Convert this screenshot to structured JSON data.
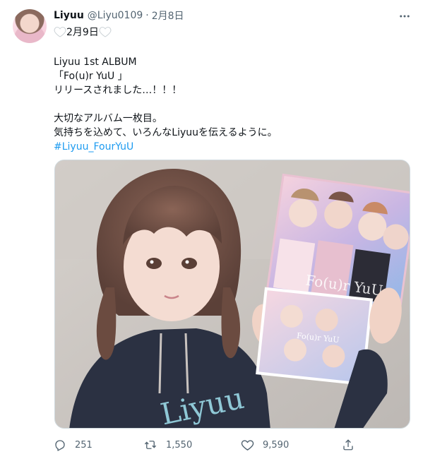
{
  "tweet": {
    "display_name": "Liyuu",
    "handle": "@Liyu0109",
    "separator": "·",
    "time": "2月8日",
    "first_line_text": "2月9日",
    "lines": [
      "Liyuu 1st ALBUM",
      "「Fo(u)r YuU 」",
      "リリースされました…！！！",
      "",
      "大切なアルバム一枚目。",
      "気持ちを込めて、いろんなLiyuuを伝えるように。"
    ],
    "hashtag": "#Liyuu_FourYuU",
    "media": {
      "album_cover_text": "Fo(u)r YuU",
      "album_small_text": "Fo(u)r YuU",
      "hoodie_text": "Liyuu"
    },
    "actions": {
      "reply_count": "251",
      "retweet_count": "1,550",
      "like_count": "9,590"
    }
  },
  "colors": {
    "text": "#0f1419",
    "secondary": "#536471",
    "link": "#1d9bf0",
    "border": "#cfd9de"
  },
  "icons": {
    "more": "more-icon",
    "reply": "reply-icon",
    "retweet": "retweet-icon",
    "like": "heart-icon",
    "share": "share-icon",
    "white_heart": "white-heart-icon"
  }
}
